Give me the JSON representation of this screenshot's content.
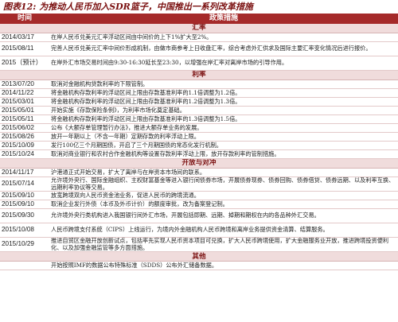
{
  "figure_title": "图表12: 为推动人民币加入SDR篮子，中国推出一系列改革措施",
  "table": {
    "headers": [
      "时间",
      "政策措施"
    ],
    "sections": [
      {
        "title": "汇率",
        "rows": [
          {
            "date": "2014/03/17",
            "text": "在岸人民币兑美元汇率浮动区间由中间价的上下1%扩大至2%。"
          },
          {
            "date": "2015/08/11",
            "text": "完善人民币兑美元汇率中间价形成机制，由做市商参考上日收盘汇率，综合考虑外汇供求及国际主要汇率变化情况后进行报价。"
          },
          {
            "date": "2015（预计）",
            "text": "在岸外汇市场交易时间由9:30-16:30延长至23:30，以增强在岸汇率对离岸市场的引导作用。"
          }
        ]
      },
      {
        "title": "利率",
        "rows": [
          {
            "date": "2013/07/20",
            "text": "取消对金融机构贷款利率的下限管制。"
          },
          {
            "date": "2014/11/22",
            "text": "将金融机构存款利率的浮动区间上限由存款基准利率的1.1倍调整为1.2倍。"
          },
          {
            "date": "2015/03/01",
            "text": "将金融机构存款利率的浮动区间上限由存款基准利率的1.2倍调整为1.3倍。"
          },
          {
            "date": "2015/05/01",
            "text": "开始实施《存款保险条例》，为利率市场化奠定基础。"
          },
          {
            "date": "2015/05/11",
            "text": "将金融机构存款利率的浮动区间上限由存款基准利率的1.3倍调整为1.5倍。"
          },
          {
            "date": "2015/06/02",
            "text": "公布《大额存单管理暂行办法》，推进大额存单业务的发展。"
          },
          {
            "date": "2015/08/26",
            "text": "放开一年期以上（不含一年期）定期存款的利率浮动上限。"
          },
          {
            "date": "2015/10/09",
            "text": "发行100亿三个月期国债，开启了三个月期国债的常态化发行机制。"
          },
          {
            "date": "2015/10/24",
            "text": "取消对商业银行和农村合作金融机构等设置存款利率浮动上限，放开存款利率的管制措施。"
          }
        ]
      },
      {
        "title": "开放与对冲",
        "rows": [
          {
            "date": "2014/11/17",
            "text": "沪港通正式开始交易，扩大了离岸与在岸资本市场间的联系。"
          },
          {
            "date": "2015/07/14",
            "text": "允许境外央行、国际金融组织、主权财富基金等进入银行间债券市场，开展债券现券、债券回购、债券借贷、债券远期、以及利率互换、远期利率协议等交易。"
          },
          {
            "date": "2015/09/10",
            "text": "放宽跨境双向人民币资金池业务，促进人民币的跨境流通。"
          },
          {
            "date": "2015/09/10",
            "text": "取消企业发行外债（本币及外币计价）的额度审批，改为备案登记制。"
          },
          {
            "date": "2015/09/30",
            "text": "允许境外央行类机构进入我国银行间外汇市场，开展包括即期、远期、掉期和期权在内的各品种外汇交易。"
          },
          {
            "date": "2015/10/08",
            "text": "人民币跨境支付系统（CIPS）上线运行，为境内外金融机构人民币跨境和离岸业务提供资金清算、结算服务。"
          },
          {
            "date": "2015/10/29",
            "text": "推进自贸区金融开放创新试点，包括率先实现人民币资本项目可兑换，扩大人民币跨境使用，扩大金融服务业开放，推进跨境投资便利化、以及加强金融监管等多方面措施。"
          }
        ]
      },
      {
        "title": "其他",
        "rows": [
          {
            "date": "",
            "text": "开始按照IMF的数据公布特殊标准（SDDS）公布外汇储备数据。"
          }
        ]
      }
    ]
  }
}
